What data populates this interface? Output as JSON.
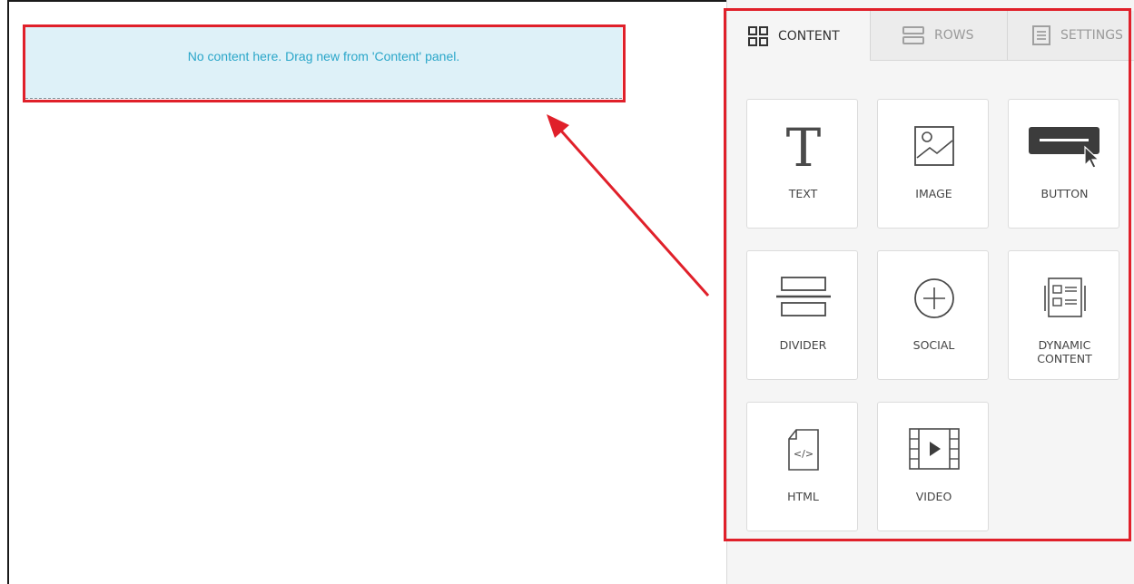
{
  "canvas": {
    "empty_message": "No content here. Drag new from 'Content' panel."
  },
  "tabs": [
    {
      "label": "CONTENT",
      "icon": "grid-icon",
      "active": true
    },
    {
      "label": "ROWS",
      "icon": "rows-icon",
      "active": false
    },
    {
      "label": "SETTINGS",
      "icon": "settings-icon",
      "active": false
    }
  ],
  "blocks": [
    {
      "label": "TEXT",
      "icon": "text-icon"
    },
    {
      "label": "IMAGE",
      "icon": "image-icon"
    },
    {
      "label": "BUTTON",
      "icon": "button-icon"
    },
    {
      "label": "DIVIDER",
      "icon": "divider-icon"
    },
    {
      "label": "SOCIAL",
      "icon": "social-icon"
    },
    {
      "label": "DYNAMIC\nCONTENT",
      "icon": "dynamic-content-icon"
    },
    {
      "label": "HTML",
      "icon": "html-icon"
    },
    {
      "label": "VIDEO",
      "icon": "video-icon"
    }
  ],
  "colors": {
    "highlight": "#e0202a",
    "dropzone_bg": "#def1f8",
    "dropzone_text": "#2aa6c9"
  }
}
